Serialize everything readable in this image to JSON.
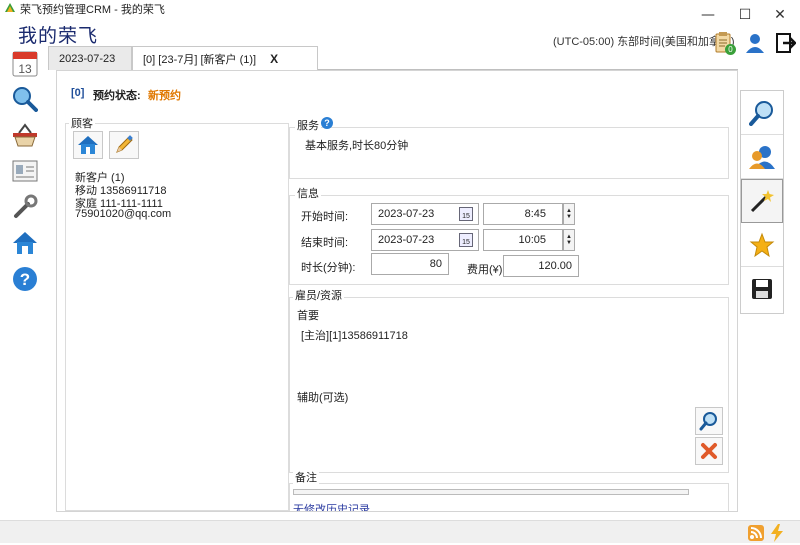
{
  "window": {
    "title": "荣飞预约管理CRM - 我的荣飞",
    "minimize": "—",
    "maximize": "☐",
    "close": "✕"
  },
  "header": {
    "title": "我的荣飞",
    "timezone": "(UTC-05:00) 东部时间(美国和加拿大)",
    "badge_count": "0"
  },
  "tabs": [
    {
      "label": "2023-07-23"
    },
    {
      "label": "[0] [23-7月] [新客户 (1)]",
      "close": "X"
    }
  ],
  "calendar_day": "13",
  "appointment": {
    "id": "[0]",
    "status_label": "预约状态:",
    "status_value": "新预约"
  },
  "customer": {
    "legend": "顾客",
    "name": "新客户 (1)",
    "mobile": "移动 13586911718",
    "home": "家庭 111-111-1111",
    "email": "75901020@qq.com"
  },
  "service": {
    "legend": "服务",
    "help": "?",
    "description": "基本服务,时长80分钟"
  },
  "info": {
    "legend": "信息",
    "start_label": "开始时间:",
    "start_date": "2023-07-23",
    "start_time": "8:45",
    "end_label": "结束时间:",
    "end_date": "2023-07-23",
    "end_time": "10:05",
    "duration_label": "时长(分钟):",
    "duration": "80",
    "fee_label": "费用(¥):",
    "fee": "120.00",
    "cal_day": "15"
  },
  "staff": {
    "legend": "雇员/资源",
    "primary_label": "首要",
    "primary_value": "[主治][1]13586911718",
    "secondary_label": "辅助(可选)"
  },
  "notes": {
    "legend": "备注",
    "link": "无修改历史记录"
  },
  "colors": {
    "accent_blue": "#1a2a6e",
    "status_orange": "#e07800",
    "id_blue": "#1f4e99"
  }
}
